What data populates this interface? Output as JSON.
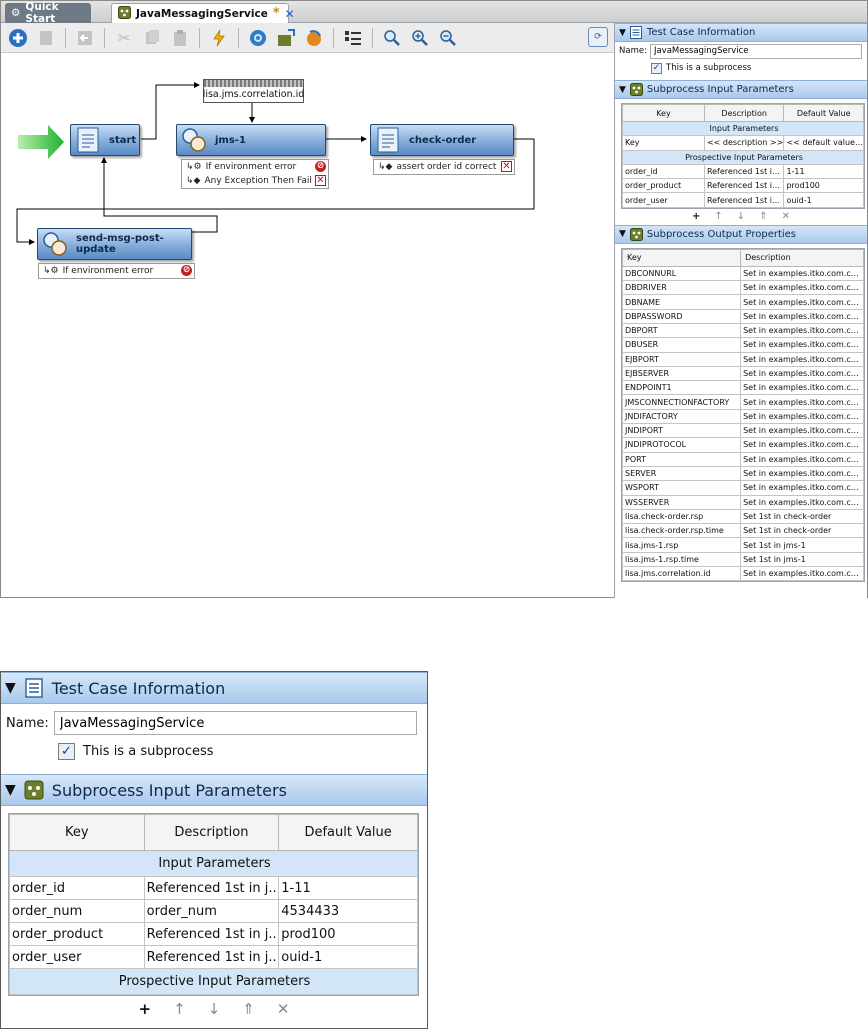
{
  "tabs": [
    {
      "label": "Quick Start",
      "active": false
    },
    {
      "label": "JavaMessagingService",
      "active": true,
      "modified_mark": "*",
      "close": "✕"
    }
  ],
  "toolbar": {
    "icons": [
      "add-step-icon",
      "delete-step-icon",
      "back-icon",
      "cut-icon",
      "copy-icon",
      "paste-icon",
      "run-icon",
      "config-icon",
      "stage-icon",
      "replay-icon",
      "properties-icon",
      "zoom-icon",
      "zoom-in-icon",
      "zoom-out-icon"
    ],
    "right_button": "link-icon"
  },
  "canvas": {
    "correlation_label": "lisa.jms.correlation.id",
    "steps": [
      {
        "name": "start"
      },
      {
        "name": "jms-1",
        "assertions": [
          {
            "label": "If environment error",
            "mark": "stop"
          },
          {
            "label": "Any Exception Then Fail",
            "mark": "x"
          }
        ]
      },
      {
        "name": "check-order",
        "assertions": [
          {
            "label": "assert order id correct",
            "mark": "x"
          }
        ]
      },
      {
        "name": "send-msg-post-update",
        "assertions": [
          {
            "label": "If environment error",
            "mark": "stop"
          }
        ]
      }
    ]
  },
  "panel": {
    "test_case_info": {
      "title": "Test Case Information",
      "name_label": "Name:",
      "name_value": "JavaMessagingService",
      "subprocess_checkbox": "This is a subprocess",
      "subprocess_checked": true
    },
    "input_params": {
      "title": "Subprocess Input Parameters",
      "columns": [
        "Key",
        "Description",
        "Default Value"
      ],
      "group_input": "Input Parameters",
      "input_rows": [
        [
          "Key",
          "<< description >>",
          "<< default value >>"
        ]
      ],
      "group_prospective": "Prospective Input Parameters",
      "prospective_rows": [
        [
          "order_id",
          "Referenced 1st in j...",
          "1-11"
        ],
        [
          "order_product",
          "Referenced 1st in j...",
          "prod100"
        ],
        [
          "order_user",
          "Referenced 1st in j...",
          "ouid-1"
        ]
      ],
      "tools": [
        "+",
        "↑",
        "↓",
        "⇑",
        "✕"
      ]
    },
    "output_props": {
      "title": "Subprocess Output Properties",
      "columns": [
        "Key",
        "Description"
      ],
      "rows": [
        [
          "DBCONNURL",
          "Set in examples.itko.com.confi..."
        ],
        [
          "DBDRIVER",
          "Set in examples.itko.com.confi..."
        ],
        [
          "DBNAME",
          "Set in examples.itko.com.confi..."
        ],
        [
          "DBPASSWORD",
          "Set in examples.itko.com.confi..."
        ],
        [
          "DBPORT",
          "Set in examples.itko.com.confi..."
        ],
        [
          "DBUSER",
          "Set in examples.itko.com.confi..."
        ],
        [
          "EJBPORT",
          "Set in examples.itko.com.confi..."
        ],
        [
          "EJBSERVER",
          "Set in examples.itko.com.confi..."
        ],
        [
          "ENDPOINT1",
          "Set in examples.itko.com.confi..."
        ],
        [
          "JMSCONNECTIONFACTORY",
          "Set in examples.itko.com.confi..."
        ],
        [
          "JNDIFACTORY",
          "Set in examples.itko.com.confi..."
        ],
        [
          "JNDIPORT",
          "Set in examples.itko.com.confi..."
        ],
        [
          "JNDIPROTOCOL",
          "Set in examples.itko.com.confi..."
        ],
        [
          "PORT",
          "Set in examples.itko.com.confi..."
        ],
        [
          "SERVER",
          "Set in examples.itko.com.confi..."
        ],
        [
          "WSPORT",
          "Set in examples.itko.com.confi..."
        ],
        [
          "WSSERVER",
          "Set in examples.itko.com.confi..."
        ],
        [
          "lisa.check-order.rsp",
          "Set 1st in check-order"
        ],
        [
          "lisa.check-order.rsp.time",
          "Set 1st in check-order"
        ],
        [
          "lisa.jms-1.rsp",
          "Set 1st in jms-1"
        ],
        [
          "lisa.jms-1.rsp.time",
          "Set 1st in jms-1"
        ],
        [
          "lisa.jms.correlation.id",
          "Set in examples.itko.com.confi..."
        ]
      ]
    }
  },
  "zoom_panel": {
    "test_case_info": {
      "title": "Test Case Information",
      "name_label": "Name:",
      "name_value": "JavaMessagingService",
      "subprocess_checkbox": "This is a subprocess",
      "subprocess_checked": true
    },
    "input_params": {
      "title": "Subprocess Input Parameters",
      "columns": [
        "Key",
        "Description",
        "Default Value"
      ],
      "group_input": "Input Parameters",
      "rows": [
        [
          "order_id",
          "Referenced 1st in j...",
          "1-11"
        ],
        [
          "order_num",
          "order_num",
          "4534433"
        ],
        [
          "order_product",
          "Referenced 1st in j...",
          "prod100"
        ],
        [
          "order_user",
          "Referenced 1st in j...",
          "ouid-1"
        ]
      ],
      "group_prospective": "Prospective Input Parameters",
      "tools": [
        "+",
        "↑",
        "↓",
        "⇑",
        "✕"
      ]
    }
  }
}
